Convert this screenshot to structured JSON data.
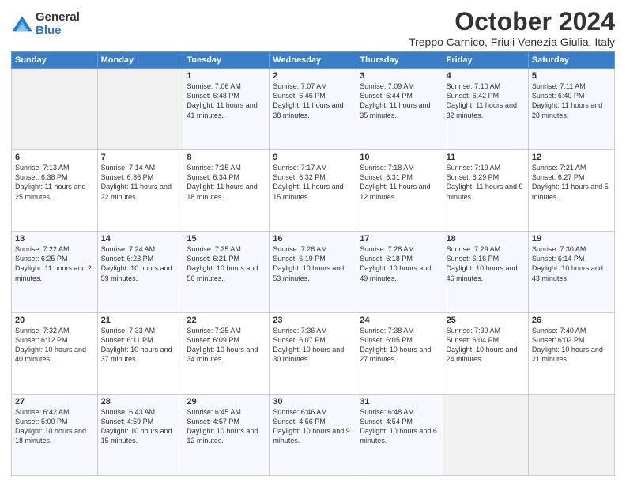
{
  "logo": {
    "general": "General",
    "blue": "Blue"
  },
  "header": {
    "month": "October 2024",
    "subtitle": "Treppo Carnico, Friuli Venezia Giulia, Italy"
  },
  "days_of_week": [
    "Sunday",
    "Monday",
    "Tuesday",
    "Wednesday",
    "Thursday",
    "Friday",
    "Saturday"
  ],
  "weeks": [
    [
      {
        "day": "",
        "info": ""
      },
      {
        "day": "",
        "info": ""
      },
      {
        "day": "1",
        "info": "Sunrise: 7:06 AM\nSunset: 6:48 PM\nDaylight: 11 hours and 41 minutes."
      },
      {
        "day": "2",
        "info": "Sunrise: 7:07 AM\nSunset: 6:46 PM\nDaylight: 11 hours and 38 minutes."
      },
      {
        "day": "3",
        "info": "Sunrise: 7:09 AM\nSunset: 6:44 PM\nDaylight: 11 hours and 35 minutes."
      },
      {
        "day": "4",
        "info": "Sunrise: 7:10 AM\nSunset: 6:42 PM\nDaylight: 11 hours and 32 minutes."
      },
      {
        "day": "5",
        "info": "Sunrise: 7:11 AM\nSunset: 6:40 PM\nDaylight: 11 hours and 28 minutes."
      }
    ],
    [
      {
        "day": "6",
        "info": "Sunrise: 7:13 AM\nSunset: 6:38 PM\nDaylight: 11 hours and 25 minutes."
      },
      {
        "day": "7",
        "info": "Sunrise: 7:14 AM\nSunset: 6:36 PM\nDaylight: 11 hours and 22 minutes."
      },
      {
        "day": "8",
        "info": "Sunrise: 7:15 AM\nSunset: 6:34 PM\nDaylight: 11 hours and 18 minutes."
      },
      {
        "day": "9",
        "info": "Sunrise: 7:17 AM\nSunset: 6:32 PM\nDaylight: 11 hours and 15 minutes."
      },
      {
        "day": "10",
        "info": "Sunrise: 7:18 AM\nSunset: 6:31 PM\nDaylight: 11 hours and 12 minutes."
      },
      {
        "day": "11",
        "info": "Sunrise: 7:19 AM\nSunset: 6:29 PM\nDaylight: 11 hours and 9 minutes."
      },
      {
        "day": "12",
        "info": "Sunrise: 7:21 AM\nSunset: 6:27 PM\nDaylight: 11 hours and 5 minutes."
      }
    ],
    [
      {
        "day": "13",
        "info": "Sunrise: 7:22 AM\nSunset: 6:25 PM\nDaylight: 11 hours and 2 minutes."
      },
      {
        "day": "14",
        "info": "Sunrise: 7:24 AM\nSunset: 6:23 PM\nDaylight: 10 hours and 59 minutes."
      },
      {
        "day": "15",
        "info": "Sunrise: 7:25 AM\nSunset: 6:21 PM\nDaylight: 10 hours and 56 minutes."
      },
      {
        "day": "16",
        "info": "Sunrise: 7:26 AM\nSunset: 6:19 PM\nDaylight: 10 hours and 53 minutes."
      },
      {
        "day": "17",
        "info": "Sunrise: 7:28 AM\nSunset: 6:18 PM\nDaylight: 10 hours and 49 minutes."
      },
      {
        "day": "18",
        "info": "Sunrise: 7:29 AM\nSunset: 6:16 PM\nDaylight: 10 hours and 46 minutes."
      },
      {
        "day": "19",
        "info": "Sunrise: 7:30 AM\nSunset: 6:14 PM\nDaylight: 10 hours and 43 minutes."
      }
    ],
    [
      {
        "day": "20",
        "info": "Sunrise: 7:32 AM\nSunset: 6:12 PM\nDaylight: 10 hours and 40 minutes."
      },
      {
        "day": "21",
        "info": "Sunrise: 7:33 AM\nSunset: 6:11 PM\nDaylight: 10 hours and 37 minutes."
      },
      {
        "day": "22",
        "info": "Sunrise: 7:35 AM\nSunset: 6:09 PM\nDaylight: 10 hours and 34 minutes."
      },
      {
        "day": "23",
        "info": "Sunrise: 7:36 AM\nSunset: 6:07 PM\nDaylight: 10 hours and 30 minutes."
      },
      {
        "day": "24",
        "info": "Sunrise: 7:38 AM\nSunset: 6:05 PM\nDaylight: 10 hours and 27 minutes."
      },
      {
        "day": "25",
        "info": "Sunrise: 7:39 AM\nSunset: 6:04 PM\nDaylight: 10 hours and 24 minutes."
      },
      {
        "day": "26",
        "info": "Sunrise: 7:40 AM\nSunset: 6:02 PM\nDaylight: 10 hours and 21 minutes."
      }
    ],
    [
      {
        "day": "27",
        "info": "Sunrise: 6:42 AM\nSunset: 5:00 PM\nDaylight: 10 hours and 18 minutes."
      },
      {
        "day": "28",
        "info": "Sunrise: 6:43 AM\nSunset: 4:59 PM\nDaylight: 10 hours and 15 minutes."
      },
      {
        "day": "29",
        "info": "Sunrise: 6:45 AM\nSunset: 4:57 PM\nDaylight: 10 hours and 12 minutes."
      },
      {
        "day": "30",
        "info": "Sunrise: 6:46 AM\nSunset: 4:56 PM\nDaylight: 10 hours and 9 minutes."
      },
      {
        "day": "31",
        "info": "Sunrise: 6:48 AM\nSunset: 4:54 PM\nDaylight: 10 hours and 6 minutes."
      },
      {
        "day": "",
        "info": ""
      },
      {
        "day": "",
        "info": ""
      }
    ]
  ]
}
